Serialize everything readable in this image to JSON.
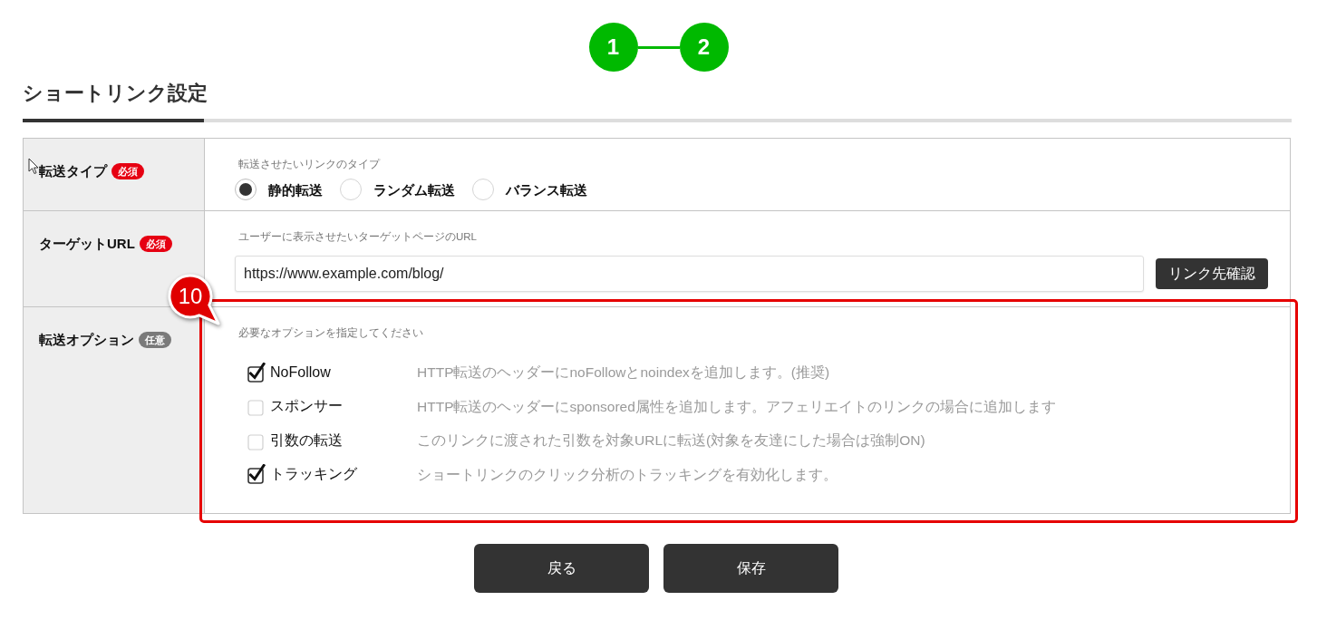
{
  "stepper": {
    "steps": [
      "1",
      "2"
    ]
  },
  "section": {
    "title": "ショートリンク設定"
  },
  "form": {
    "rows": [
      {
        "kind": "radio",
        "label": "転送タイプ",
        "badge": {
          "kind": "required",
          "text": "必須"
        },
        "hint": "転送させたいリンクのタイプ",
        "options": [
          {
            "label": "静的転送",
            "selected": true
          },
          {
            "label": "ランダム転送",
            "selected": false
          },
          {
            "label": "バランス転送",
            "selected": false
          }
        ]
      },
      {
        "kind": "url",
        "label": "ターゲットURL",
        "badge": {
          "kind": "required",
          "text": "必須"
        },
        "hint": "ユーザーに表示させたいターゲットページのURL",
        "value": "https://www.example.com/blog/",
        "button": "リンク先確認"
      },
      {
        "kind": "checkboxes",
        "label": "転送オプション",
        "badge": {
          "kind": "optional",
          "text": "任意"
        },
        "hint": "必要なオプションを指定してください",
        "options": [
          {
            "label": "NoFollow",
            "checked": true,
            "description": "HTTP転送のヘッダーにnoFollowとnoindexを追加します。(推奨)"
          },
          {
            "label": "スポンサー",
            "checked": false,
            "description": "HTTP転送のヘッダーにsponsored属性を追加します。アフェリエイトのリンクの場合に追加します"
          },
          {
            "label": "引数の転送",
            "checked": false,
            "description": "このリンクに渡された引数を対象URLに転送(対象を友達にした場合は強制ON)"
          },
          {
            "label": "トラッキング",
            "checked": true,
            "description": "ショートリンクのクリック分析のトラッキングを有効化します。"
          }
        ]
      }
    ]
  },
  "annotation": {
    "number": "10"
  },
  "buttons": [
    "戻る",
    "保存"
  ]
}
